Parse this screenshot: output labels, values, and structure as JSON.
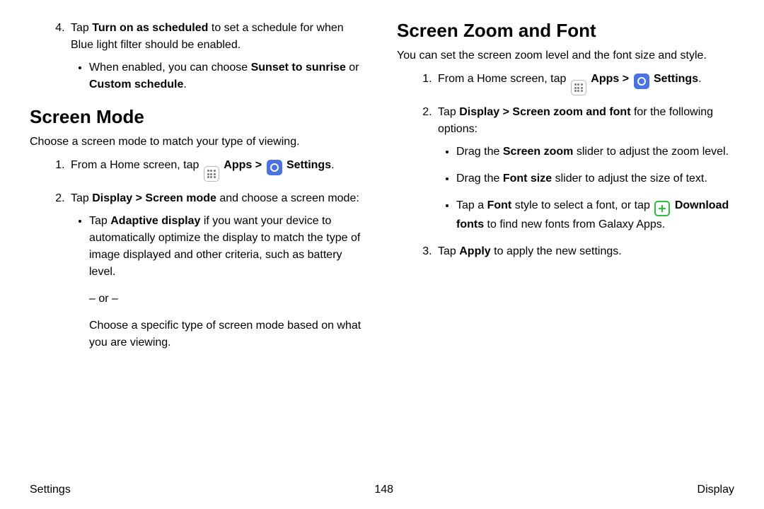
{
  "left": {
    "step4": {
      "pre": "Tap ",
      "bold": "Turn on as scheduled",
      "post": " to set a schedule for when Blue light filter should be enabled.",
      "bullet": {
        "pre": "When enabled, you can choose ",
        "b1": "Sunset to sunrise",
        "mid": " or ",
        "b2": "Custom schedule",
        "post": "."
      }
    },
    "heading": "Screen Mode",
    "lead": "Choose a screen mode to match your type of viewing.",
    "step1": {
      "pre": "From a Home screen, tap ",
      "apps": "Apps",
      "chev": " > ",
      "settings": "Settings",
      "post": "."
    },
    "step2": {
      "pre": "Tap ",
      "b1": "Display > Screen mode",
      "post": " and choose a screen mode:",
      "bullet": {
        "pre": "Tap ",
        "b1": "Adaptive display",
        "post": " if you want your device to automatically optimize the display to match the type of image displayed and other criteria, such as battery level."
      },
      "or": "– or –",
      "alt": "Choose a specific type of screen mode based on what you are viewing."
    }
  },
  "right": {
    "heading": "Screen Zoom and Font",
    "lead": "You can set the screen zoom level and the font size and style.",
    "step1": {
      "pre": "From a Home screen, tap ",
      "apps": "Apps",
      "chev": " > ",
      "settings": "Settings",
      "post": "."
    },
    "step2": {
      "pre": "Tap ",
      "b1": "Display > Screen zoom and font",
      "post": " for the following options:",
      "bullets": {
        "b1": {
          "pre": "Drag the ",
          "bold": "Screen zoom",
          "post": " slider to adjust the zoom level."
        },
        "b2": {
          "pre": "Drag the ",
          "bold": "Font size",
          "post": " slider to adjust the size of text."
        },
        "b3": {
          "pre": "Tap a ",
          "bold": "Font",
          "mid": " style to select a font, or tap ",
          "bold2": "Download fonts",
          "post": " to find new fonts from Galaxy Apps."
        }
      }
    },
    "step3": {
      "pre": "Tap ",
      "bold": "Apply",
      "post": " to apply the new settings."
    }
  },
  "footer": {
    "left": "Settings",
    "center": "148",
    "right": "Display"
  }
}
